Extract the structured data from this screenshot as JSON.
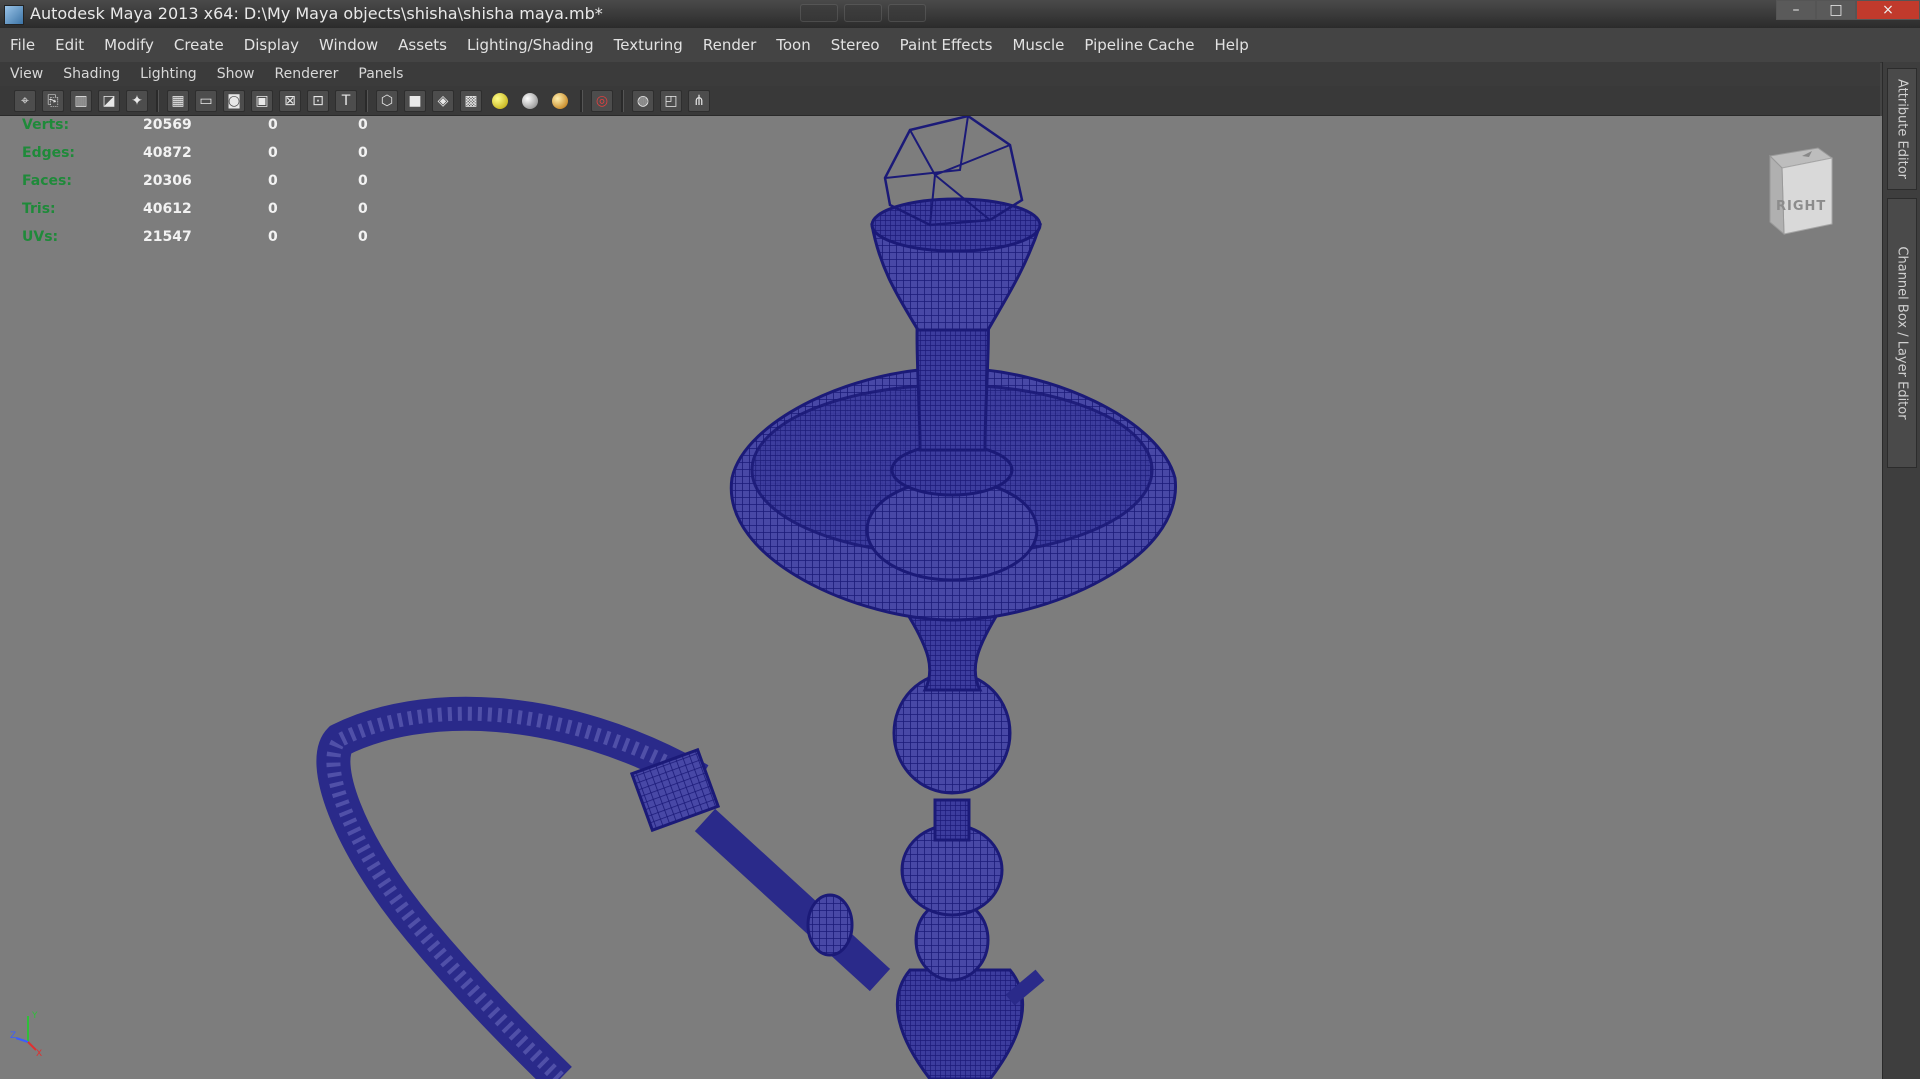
{
  "window": {
    "title": "Autodesk Maya 2013 x64: D:\\My Maya objects\\shisha\\shisha maya.mb*",
    "controls": {
      "minimize": "–",
      "maximize": "□",
      "close": "×"
    }
  },
  "main_menu": [
    "File",
    "Edit",
    "Modify",
    "Create",
    "Display",
    "Window",
    "Assets",
    "Lighting/Shading",
    "Texturing",
    "Render",
    "Toon",
    "Stereo",
    "Paint Effects",
    "Muscle",
    "Pipeline Cache",
    "Help"
  ],
  "panel_menu": [
    "View",
    "Shading",
    "Lighting",
    "Show",
    "Renderer",
    "Panels"
  ],
  "hud": {
    "rows": [
      {
        "label": "Verts:",
        "values": [
          "20569",
          "0",
          "0"
        ]
      },
      {
        "label": "Edges:",
        "values": [
          "40872",
          "0",
          "0"
        ]
      },
      {
        "label": "Faces:",
        "values": [
          "20306",
          "0",
          "0"
        ]
      },
      {
        "label": "Tris:",
        "values": [
          "40612",
          "0",
          "0"
        ]
      },
      {
        "label": "UVs:",
        "values": [
          "21547",
          "0",
          "0"
        ]
      }
    ]
  },
  "viewcube": {
    "face_label": "RIGHT"
  },
  "axis": {
    "y": "Y",
    "z": "Z",
    "x": "X"
  },
  "side_tabs": {
    "attribute_editor": "Attribute Editor",
    "channel_box": "Channel Box / Layer Editor"
  },
  "colors": {
    "wireframe": "#1b1a78",
    "viewport_bg": "#7d7d7d",
    "hud_label": "#1f8a3a"
  }
}
